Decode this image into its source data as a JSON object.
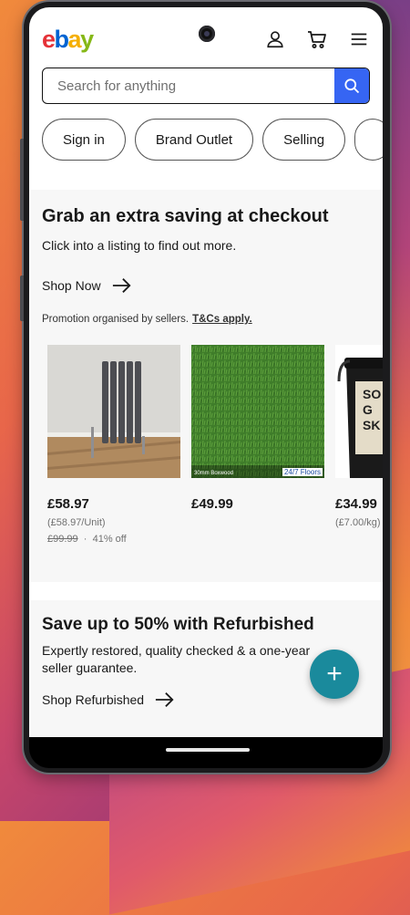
{
  "header": {
    "logo": [
      "e",
      "b",
      "a",
      "y"
    ],
    "icons": [
      "user-icon",
      "cart-icon",
      "menu-icon"
    ]
  },
  "search": {
    "placeholder": "Search for anything",
    "value": ""
  },
  "chips": [
    {
      "label": "Sign in"
    },
    {
      "label": "Brand Outlet"
    },
    {
      "label": "Selling"
    }
  ],
  "promo": {
    "title": "Grab an extra saving at checkout",
    "subtitle": "Click into a listing to find out more.",
    "link": "Shop Now",
    "note": "Promotion organised by sellers.",
    "note_link": "T&Cs apply.",
    "products": [
      {
        "price": "£58.97",
        "unit": "(£58.97/Unit)",
        "was": "£99.99",
        "sep": "·",
        "discount": "41% off",
        "image": "radiator"
      },
      {
        "price": "£49.99",
        "image": "artificial-grass",
        "caption_left": "30mm Boxwood",
        "caption_right": "24/7 Floors"
      },
      {
        "price": "£34.99",
        "unit": "(£7.00/kg)",
        "image": "paint-tub",
        "tub_text": [
          "SO",
          "G",
          "SK"
        ]
      }
    ]
  },
  "refurb": {
    "title": "Save up to 50% with Refurbished",
    "subtitle": "Expertly restored, quality checked & a one-year seller guarantee.",
    "link": "Shop Refurbished"
  },
  "fab": {
    "label": "+"
  },
  "colors": {
    "accent": "#3665f3",
    "fab": "#1a8a9c"
  }
}
